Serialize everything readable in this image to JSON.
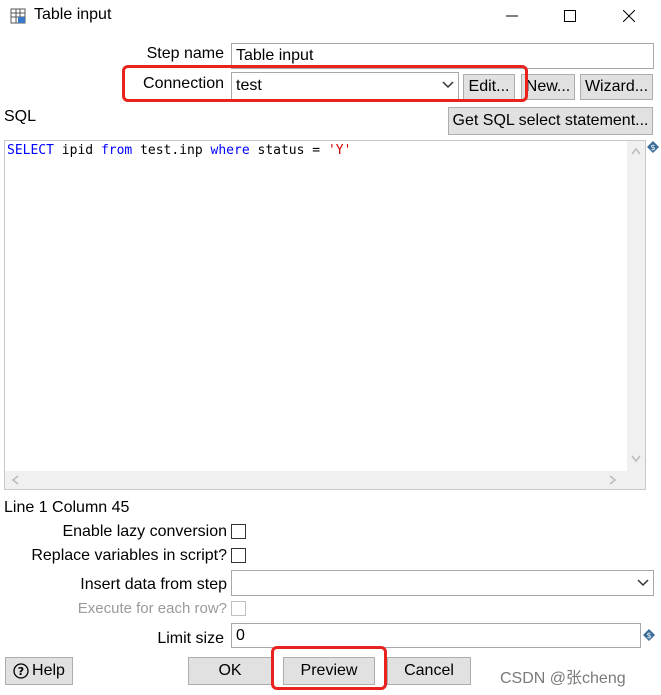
{
  "window": {
    "title": "Table input",
    "app_icon": "table-grid-icon",
    "controls": [
      "minimize-icon",
      "maximize-icon",
      "close-icon"
    ]
  },
  "form": {
    "step_name_label": "Step name",
    "step_name_value": "Table input",
    "connection_label": "Connection",
    "connection_value": "test",
    "edit_label": "Edit...",
    "new_label": "New...",
    "wizard_label": "Wizard...",
    "sql_label": "SQL",
    "get_sql_label": "Get SQL select statement...",
    "sql_text": "SELECT ipid from test.inp where status = 'Y'",
    "position_status": "Line 1 Column 45",
    "lazy_label": "Enable lazy conversion",
    "lazy_checked": false,
    "replace_vars_label": "Replace variables in script?",
    "replace_vars_checked": false,
    "insert_data_label": "Insert data from step",
    "insert_data_value": "",
    "execute_each_label": "Execute for each row?",
    "execute_each_checked": false,
    "limit_label": "Limit size",
    "limit_value": "0"
  },
  "buttons": {
    "help": "Help",
    "ok": "OK",
    "preview": "Preview",
    "cancel": "Cancel"
  },
  "watermark": "CSDN @张cheng",
  "colors": {
    "highlight": "#e8231f",
    "sql_keyword": "#0000ff",
    "sql_string": "#d00000"
  }
}
